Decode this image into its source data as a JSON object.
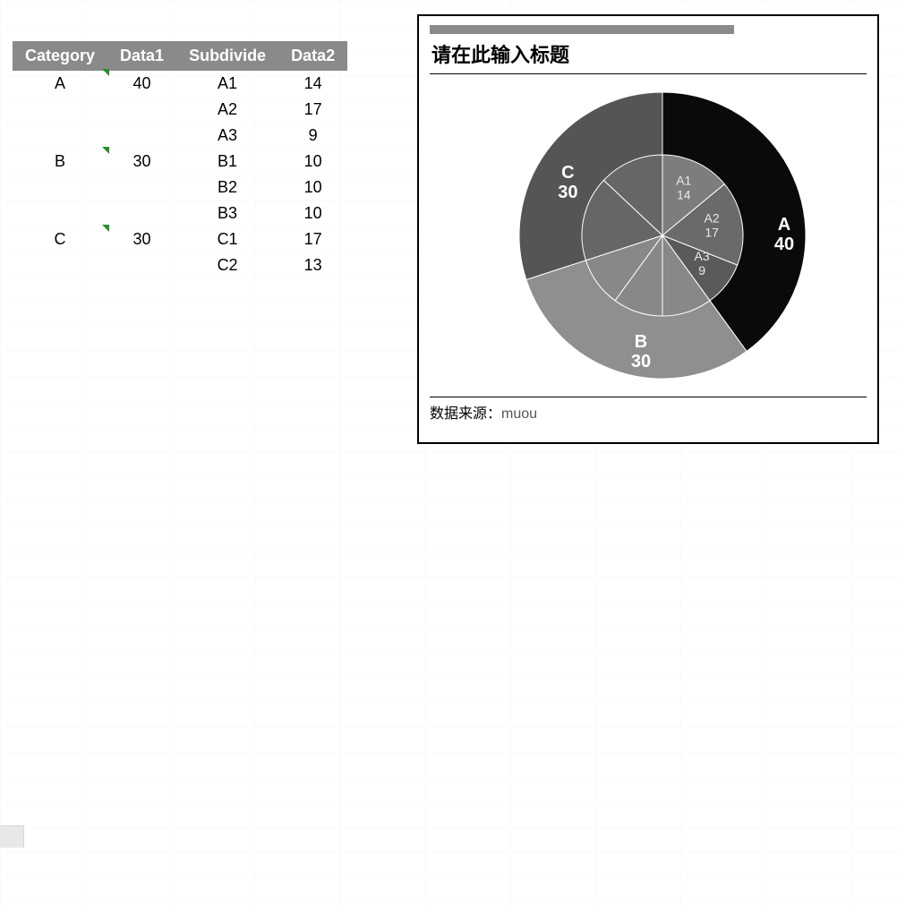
{
  "table": {
    "headers": [
      "Category",
      "Data1",
      "Subdivide",
      "Data2"
    ],
    "rows": [
      {
        "category": "A",
        "data1": "40",
        "sub": "A1",
        "data2": "14",
        "mark": true
      },
      {
        "category": "",
        "data1": "",
        "sub": "A2",
        "data2": "17",
        "mark": false
      },
      {
        "category": "",
        "data1": "",
        "sub": "A3",
        "data2": "9",
        "mark": false
      },
      {
        "category": "B",
        "data1": "30",
        "sub": "B1",
        "data2": "10",
        "mark": true
      },
      {
        "category": "",
        "data1": "",
        "sub": "B2",
        "data2": "10",
        "mark": false
      },
      {
        "category": "",
        "data1": "",
        "sub": "B3",
        "data2": "10",
        "mark": false
      },
      {
        "category": "C",
        "data1": "30",
        "sub": "C1",
        "data2": "17",
        "mark": true
      },
      {
        "category": "",
        "data1": "",
        "sub": "C2",
        "data2": "13",
        "mark": false
      }
    ]
  },
  "chart": {
    "title": "请在此输入标题",
    "footer_label": "数据来源：",
    "footer_value": "muou"
  },
  "chart_data": {
    "type": "pie",
    "title": "请在此输入标题",
    "outer": {
      "series_name": "Category / Data1",
      "categories": [
        "A",
        "B",
        "C"
      ],
      "values": [
        40,
        30,
        30
      ],
      "colors": [
        "#0a0a0a",
        "#8f8f8f",
        "#555555"
      ]
    },
    "inner": {
      "series_name": "Subdivide / Data2",
      "categories": [
        "A1",
        "A2",
        "A3",
        "B1",
        "B2",
        "B3",
        "C1",
        "C2"
      ],
      "values": [
        14,
        17,
        9,
        10,
        10,
        10,
        17,
        13
      ],
      "colors": [
        "#7d7d7d",
        "#6a6a6a",
        "#5a5a5a",
        "#888",
        "#888",
        "#888",
        "#666",
        "#666"
      ]
    },
    "visible_inner_labels": [
      "A1",
      "A2",
      "A3"
    ],
    "source": "muou"
  }
}
